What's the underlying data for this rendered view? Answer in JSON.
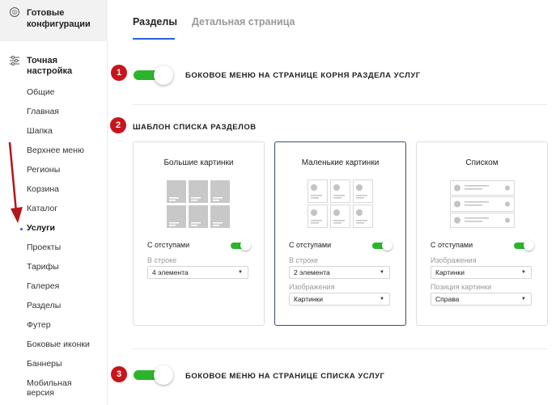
{
  "sidebar": {
    "top_label": "Готовые конфигурации",
    "section_label": "Точная настройка",
    "items": [
      "Общие",
      "Главная",
      "Шапка",
      "Верхнее меню",
      "Регионы",
      "Корзина",
      "Каталог",
      "Услуги",
      "Проекты",
      "Тарифы",
      "Галерея",
      "Разделы",
      "Футер",
      "Боковые иконки",
      "Баннеры",
      "Мобильная версия"
    ],
    "active_item": "Услуги"
  },
  "tabs": [
    "Разделы",
    "Детальная страница"
  ],
  "badges": [
    "1",
    "2",
    "3"
  ],
  "sections": {
    "menu_root": "БОКОВОЕ МЕНЮ НА СТРАНИЦЕ КОРНЯ РАЗДЕЛА УСЛУГ",
    "template_list": "ШАБЛОН СПИСКА РАЗДЕЛОВ",
    "menu_list": "БОКОВОЕ МЕНЮ НА СТРАНИЦЕ СПИСКА УСЛУГ"
  },
  "cards": [
    {
      "title": "Большие картинки",
      "option": "С отступами",
      "field1_label": "В строке",
      "field1_value": "4 элемента"
    },
    {
      "title": "Маленькие картинки",
      "option": "С отступами",
      "field1_label": "В строке",
      "field1_value": "2 элемента",
      "field2_label": "Изображения",
      "field2_value": "Картинки"
    },
    {
      "title": "Списком",
      "option": "С отступами",
      "field1_label": "Изображения",
      "field1_value": "Картинки",
      "field2_label": "Позиция картинки",
      "field2_value": "Справа"
    }
  ],
  "colors": {
    "accent": "#2b5fd8",
    "badge": "#c8141c",
    "toggle_on": "#2cb52c",
    "selected_border": "#3c4a7a"
  }
}
